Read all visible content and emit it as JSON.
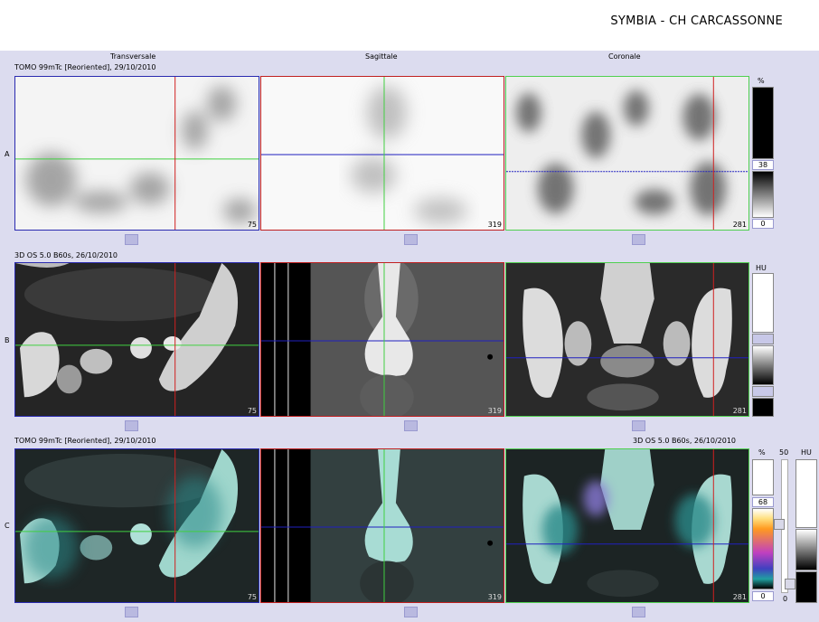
{
  "header": {
    "title": "SYMBIA - CH CARCASSONNE"
  },
  "columns": [
    "Transversale",
    "Sagittale",
    "Coronale"
  ],
  "rows": [
    {
      "label": "A",
      "series": "TOMO 99mTc [Reoriented], 29/10/2010",
      "slices": [
        "75",
        "319",
        "281"
      ]
    },
    {
      "label": "B",
      "series": "3D  OS  5.0  B60s, 26/10/2010",
      "slices": [
        "75",
        "319",
        "281"
      ]
    },
    {
      "label": "C",
      "series": "TOMO 99mTc [Reoriented], 29/10/2010",
      "series_right": "3D  OS  5.0  B60s, 26/10/2010",
      "slices": [
        "75",
        "319",
        "281"
      ]
    }
  ],
  "scales": {
    "a": {
      "unit": "%",
      "top_value": "38",
      "bottom_value": "0"
    },
    "b": {
      "unit": "HU"
    },
    "c": {
      "unit": "%",
      "top_value": "68",
      "bottom_value": "0",
      "mid_label": "50",
      "bottom_small": "0",
      "unit2": "HU"
    }
  },
  "colors": {
    "crosshair_red": "#d02020",
    "crosshair_green": "#40d040",
    "crosshair_blue": "#2020c0",
    "frame_blue": "#2a2ab0",
    "frame_red": "#c02020",
    "frame_green": "#50d050"
  }
}
